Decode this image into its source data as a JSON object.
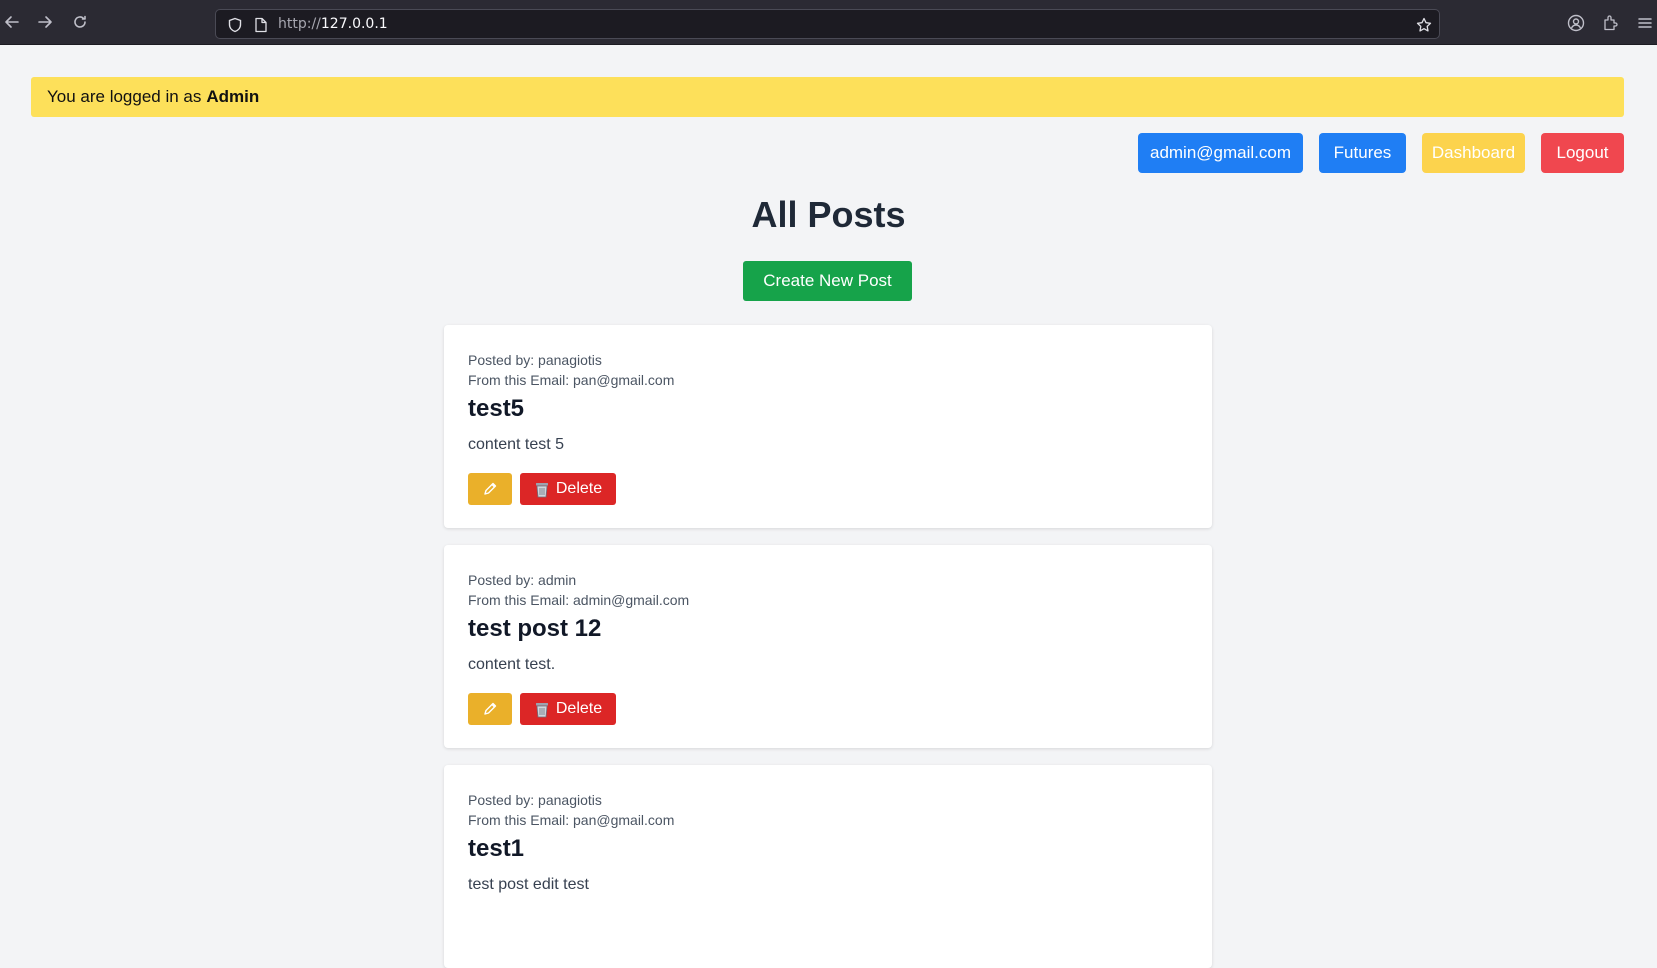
{
  "browser": {
    "url_protocol": "http://",
    "url_host": "127.0.0.1",
    "icons": [
      "back-arrow-icon",
      "forward-arrow-icon",
      "reload-icon",
      "shield-icon",
      "page-icon",
      "star-icon",
      "account-icon",
      "extensions-icon",
      "menu-icon"
    ]
  },
  "banner": {
    "prefix": "You are logged in as",
    "role": "Admin"
  },
  "header": {
    "email_label": "admin@gmail.com",
    "futures_label": "Futures",
    "dashboard_label": "Dashboard",
    "logout_label": "Logout"
  },
  "colors": {
    "email_button": "#1f7ef4",
    "futures_button": "#1f7ef4",
    "dashboard_button": "#fcd34d",
    "logout_button": "#f0474f",
    "create_button": "#16a34a",
    "edit_button": "#eab02a",
    "delete_button": "#dc2626",
    "banner": "#fde05a"
  },
  "main": {
    "title": "All Posts",
    "create_label": "Create New Post"
  },
  "posts": [
    {
      "posted_by_label": "Posted by:",
      "author": "panagiotis",
      "email_label": "From this Email:",
      "email": "pan@gmail.com",
      "title": "test5",
      "content": "content test 5",
      "delete_label": "Delete"
    },
    {
      "posted_by_label": "Posted by:",
      "author": "admin",
      "email_label": "From this Email:",
      "email": "admin@gmail.com",
      "title": "test post 12",
      "content": "content test.",
      "delete_label": "Delete"
    },
    {
      "posted_by_label": "Posted by:",
      "author": "panagiotis",
      "email_label": "From this Email:",
      "email": "pan@gmail.com",
      "title": "test1",
      "content": "test post edit test"
    }
  ]
}
